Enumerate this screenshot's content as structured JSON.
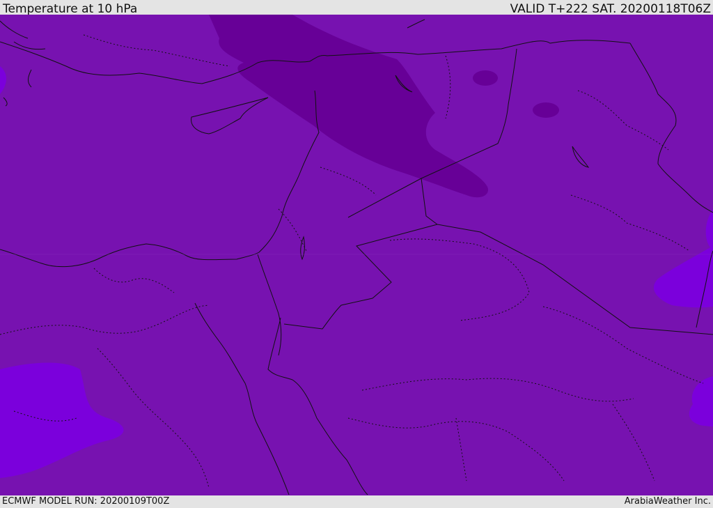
{
  "header": {
    "title": "Temperature at 10 hPa",
    "valid": "VALID T+222 SAT. 20200118T06Z"
  },
  "footer": {
    "model_run": "ECMWF MODEL RUN: 20200109T00Z",
    "credit": "ArabiaWeather Inc."
  },
  "colors": {
    "base_fill": "#7712b0",
    "cold_band": "#670097",
    "warm_patch": "#7b00dc",
    "borders": "#111111"
  }
}
